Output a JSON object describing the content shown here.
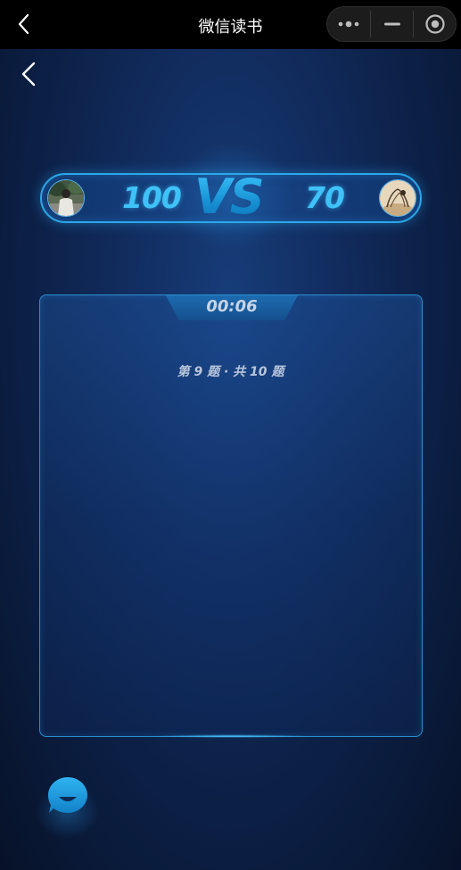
{
  "titlebar": {
    "title": "微信读书",
    "back_icon": "chevron-left-icon",
    "more_icon": "more-dots-icon",
    "minimize_icon": "minimize-icon",
    "close_icon": "target-circle-icon"
  },
  "page": {
    "back_icon": "chevron-left-icon"
  },
  "battle": {
    "left_score": "100",
    "right_score": "70",
    "vs_label": "VS"
  },
  "question": {
    "timer": "00:06",
    "progress": "第 9 题 · 共 10 题"
  },
  "chat": {
    "icon": "chat-bubble-icon"
  },
  "colors": {
    "accent": "#3fc2f7",
    "border": "#2aa7e8",
    "background": "#0b1d40"
  }
}
